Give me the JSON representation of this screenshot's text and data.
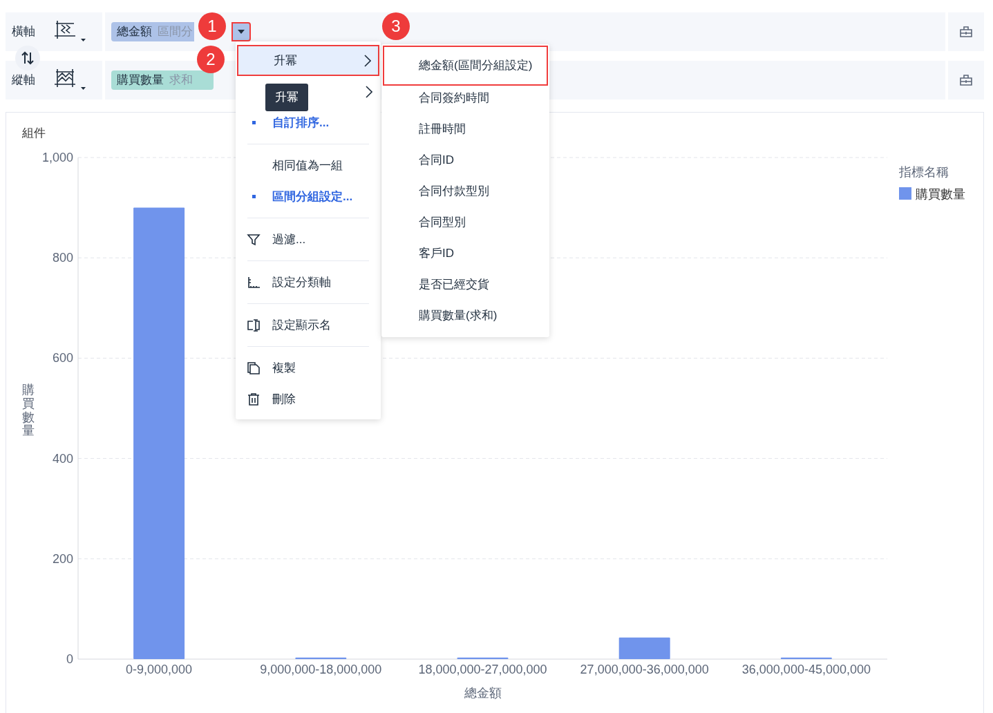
{
  "shelves": [
    {
      "label": "橫軸",
      "field": {
        "name": "總金額",
        "aggregate_parts": [
          "區間分"
        ],
        "color": "#adc2e8",
        "dropdown_outlined": true
      }
    },
    {
      "label": "縱軸",
      "field": {
        "name": "購買數量",
        "aggregate_parts": [
          "求和"
        ],
        "color": "#a9ddd6"
      }
    }
  ],
  "callouts": [
    "1",
    "2",
    "3"
  ],
  "menu": {
    "items": [
      {
        "kind": "submenu",
        "label": "升冪",
        "highlighted": true,
        "outlined": true
      },
      {
        "kind": "submenu",
        "highlighted": false,
        "outlined": false
      },
      {
        "kind": "option",
        "label": "自訂排序...",
        "selected": true
      },
      {
        "kind": "divider"
      },
      {
        "kind": "option",
        "label": "相同值為一組",
        "selected": false
      },
      {
        "kind": "option",
        "label": "區間分組設定...",
        "selected": true
      },
      {
        "kind": "divider"
      },
      {
        "kind": "action",
        "label": "過濾..."
      },
      {
        "kind": "divider"
      },
      {
        "kind": "action",
        "label": "設定分類軸"
      },
      {
        "kind": "divider"
      },
      {
        "kind": "action",
        "label": "設定顯示名"
      },
      {
        "kind": "divider"
      },
      {
        "kind": "action",
        "label": "複製"
      },
      {
        "kind": "action",
        "label": "刪除"
      }
    ],
    "tooltip": "升冪"
  },
  "submenu": {
    "items": [
      {
        "label": "總金額(區間分組設定)",
        "outlined": true
      },
      {
        "label": "合同簽約時間",
        "outlined": false
      },
      {
        "label": "註冊時間",
        "outlined": false
      },
      {
        "label": "合同ID",
        "outlined": false
      },
      {
        "label": "合同付款型別",
        "outlined": false
      },
      {
        "label": "合同型別",
        "outlined": false
      },
      {
        "label": "客戶ID",
        "outlined": false
      },
      {
        "label": "是否已經交貨",
        "outlined": false
      },
      {
        "label": "購買數量(求和)",
        "outlined": false
      }
    ]
  },
  "chart_panel": {
    "title": "組件",
    "legend_title": "指標名稱",
    "chart_data": {
      "type": "bar",
      "xlabel": "總金額",
      "ylabel": "購買數量",
      "categories": [
        "0-9,000,000",
        "9,000,000-18,000,000",
        "18,000,000-27,000,000",
        "27,000,000-36,000,000",
        "36,000,000-45,000,000"
      ],
      "series": [
        {
          "name": "購買數量",
          "color": "#7094ec",
          "values": [
            900,
            3,
            3,
            43,
            3
          ]
        }
      ],
      "ylim": [
        0,
        1000
      ],
      "grid": true,
      "yticks": [
        {
          "value": 0,
          "label": "0"
        },
        {
          "value": 200,
          "label": "200"
        },
        {
          "value": 400,
          "label": "400"
        },
        {
          "value": 600,
          "label": "600"
        },
        {
          "value": 800,
          "label": "800"
        },
        {
          "value": 1000,
          "label": "1,000"
        }
      ]
    }
  }
}
